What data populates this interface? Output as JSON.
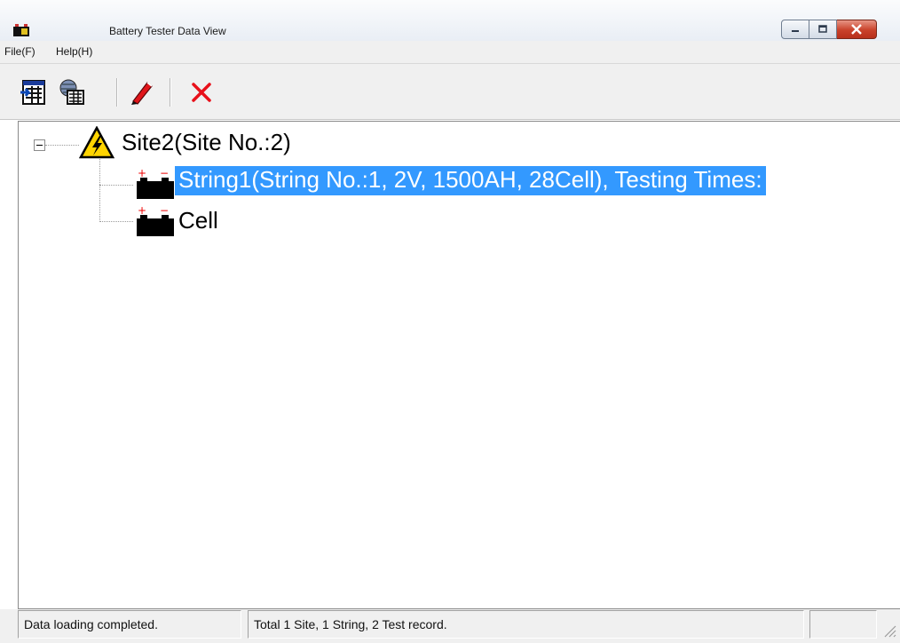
{
  "window": {
    "title": "Battery Tester Data View"
  },
  "menu": {
    "file": "File(F)",
    "help": "Help(H)"
  },
  "toolbar": {
    "buttons": [
      {
        "icon": "import-data-icon"
      },
      {
        "icon": "network-database-icon"
      },
      {
        "icon": "edit-pencil-icon"
      },
      {
        "icon": "delete-x-icon"
      }
    ]
  },
  "tree": {
    "site": {
      "label": "Site2(Site No.:2)",
      "icon": "high-voltage-warning-icon",
      "expanded": true
    },
    "children": [
      {
        "label": "String1(String No.:1, 2V, 1500AH, 28Cell), Testing Times:",
        "icon": "battery-icon",
        "selected": true
      },
      {
        "label": "Cell",
        "icon": "battery-icon",
        "selected": false
      }
    ]
  },
  "status": {
    "left": "Data loading completed.",
    "middle": "Total 1 Site, 1 String, 2 Test record.",
    "right": ""
  },
  "colors": {
    "selection": "#3399ff",
    "close_button": "#c9412a",
    "delete_icon": "#e8101a"
  }
}
